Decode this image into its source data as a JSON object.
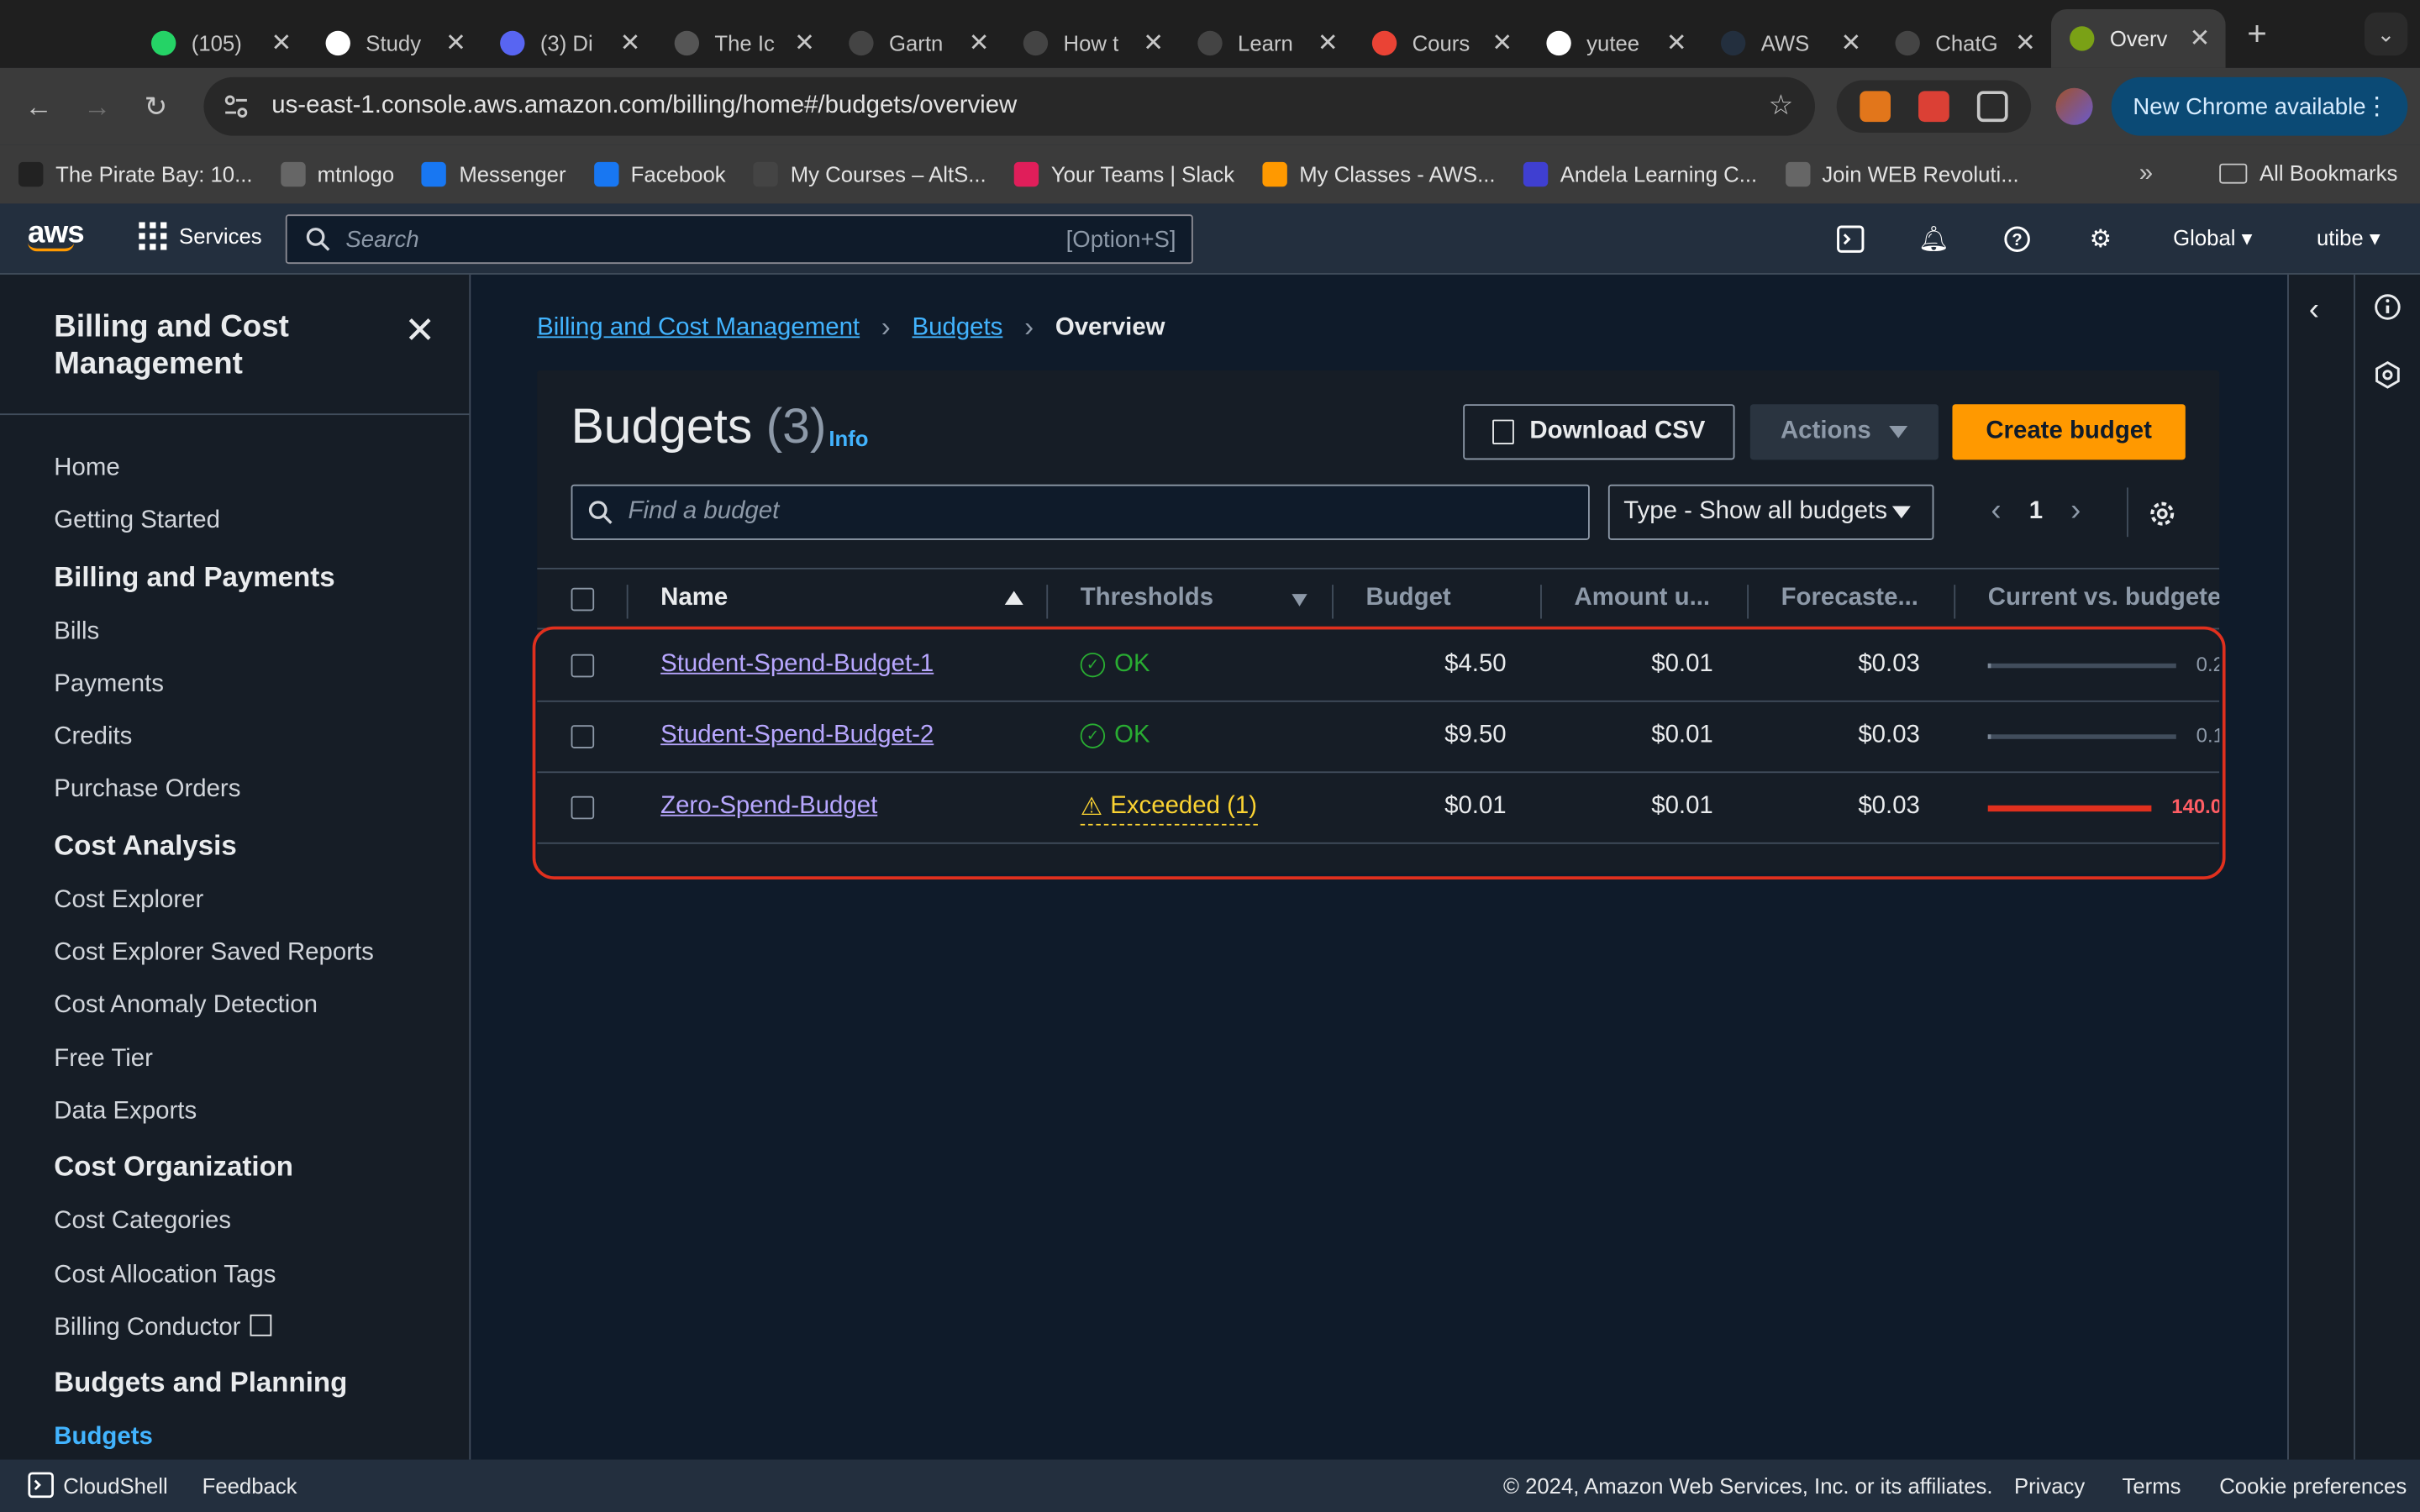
{
  "browser": {
    "tabs": [
      {
        "title": "(105)",
        "color": "#25d366",
        "icon": "whatsapp-icon"
      },
      {
        "title": "Study",
        "color": "#ffffff",
        "icon": "notion-icon"
      },
      {
        "title": "(3) Di",
        "color": "#5865f2",
        "icon": "discord-icon"
      },
      {
        "title": "The Ic",
        "color": "#555555",
        "icon": "gear-site-icon"
      },
      {
        "title": "Gartn",
        "color": "#444444",
        "icon": "g-icon"
      },
      {
        "title": "How t",
        "color": "#444444",
        "icon": "link-icon"
      },
      {
        "title": "Learn",
        "color": "#444444",
        "icon": "learn-icon"
      },
      {
        "title": "Cours",
        "color": "#ea4335",
        "icon": "courses-icon"
      },
      {
        "title": "yutee",
        "color": "#ffffff",
        "icon": "github-icon"
      },
      {
        "title": "AWS",
        "color": "#232f3e",
        "icon": "aws-icon"
      },
      {
        "title": "ChatG",
        "color": "#444444",
        "icon": "openai-icon"
      },
      {
        "title": "Overv",
        "color": "#7aa116",
        "icon": "billing-icon"
      }
    ],
    "url_host": "us-east-1.console.aws.amazon.com",
    "url_path": "/billing/home#/budgets/overview",
    "new_chrome": "New Chrome available",
    "bookmarks": [
      {
        "label": "The Pirate Bay: 10...",
        "color": "#222222",
        "icon": "pirate-icon"
      },
      {
        "label": "mtnlogo",
        "color": "#666666",
        "icon": "globe-icon"
      },
      {
        "label": "Messenger",
        "color": "#1877f2",
        "icon": "facebook-icon"
      },
      {
        "label": "Facebook",
        "color": "#1877f2",
        "icon": "facebook-icon"
      },
      {
        "label": "My Courses – AltS...",
        "color": "#444444",
        "icon": "altschool-icon"
      },
      {
        "label": "Your Teams | Slack",
        "color": "#e01e5a",
        "icon": "slack-icon"
      },
      {
        "label": "My Classes - AWS...",
        "color": "#ff9900",
        "icon": "aws-box-icon"
      },
      {
        "label": "Andela Learning C...",
        "color": "#3f3fd1",
        "icon": "andela-icon"
      },
      {
        "label": "Join WEB Revoluti...",
        "color": "#666666",
        "icon": "globe-icon"
      }
    ],
    "all_bookmarks": "All Bookmarks"
  },
  "aws_nav": {
    "logo": "aws",
    "services": "Services",
    "search_placeholder": "Search",
    "search_hint": "[Option+S]",
    "region": "Global",
    "user": "utibe"
  },
  "sidebar": {
    "title": "Billing and Cost Management",
    "items": [
      {
        "label": "Home",
        "type": "item"
      },
      {
        "label": "Getting Started",
        "type": "item"
      },
      {
        "label": "Billing and Payments",
        "type": "head"
      },
      {
        "label": "Bills",
        "type": "item"
      },
      {
        "label": "Payments",
        "type": "item"
      },
      {
        "label": "Credits",
        "type": "item"
      },
      {
        "label": "Purchase Orders",
        "type": "item"
      },
      {
        "label": "Cost Analysis",
        "type": "head"
      },
      {
        "label": "Cost Explorer",
        "type": "item"
      },
      {
        "label": "Cost Explorer Saved Reports",
        "type": "item"
      },
      {
        "label": "Cost Anomaly Detection",
        "type": "item"
      },
      {
        "label": "Free Tier",
        "type": "item"
      },
      {
        "label": "Data Exports",
        "type": "item"
      },
      {
        "label": "Cost Organization",
        "type": "head"
      },
      {
        "label": "Cost Categories",
        "type": "item"
      },
      {
        "label": "Cost Allocation Tags",
        "type": "item"
      },
      {
        "label": "Billing Conductor",
        "type": "item"
      },
      {
        "label": "Budgets and Planning",
        "type": "head"
      },
      {
        "label": "Budgets",
        "type": "active"
      }
    ]
  },
  "breadcrumb": {
    "items": [
      "Billing and Cost Management",
      "Budgets"
    ],
    "current": "Overview"
  },
  "budgets": {
    "title": "Budgets",
    "count": "(3)",
    "info": "Info",
    "download_csv": "Download CSV",
    "actions": "Actions",
    "create": "Create budget",
    "find_placeholder": "Find a budget",
    "type_filter": "Type - Show all budgets",
    "page": "1",
    "columns": [
      "Name",
      "Thresholds",
      "Budget",
      "Amount u...",
      "Forecaste...",
      "Current vs. budgeted"
    ],
    "rows": [
      {
        "name": "Student-Spend-Budget-1",
        "threshold": "OK",
        "status": "ok",
        "budget": "$4.50",
        "amount": "$0.01",
        "forecast": "$0.03",
        "progress": 0.0022,
        "pct": "0.2"
      },
      {
        "name": "Student-Spend-Budget-2",
        "threshold": "OK",
        "status": "ok",
        "budget": "$9.50",
        "amount": "$0.01",
        "forecast": "$0.03",
        "progress": 0.0011,
        "pct": "0.1"
      },
      {
        "name": "Zero-Spend-Budget",
        "threshold": "Exceeded (1)",
        "status": "exceeded",
        "budget": "$0.01",
        "amount": "$0.01",
        "forecast": "$0.03",
        "progress": 1.0,
        "pct": "140.0"
      }
    ]
  },
  "footer": {
    "cloudshell": "CloudShell",
    "feedback": "Feedback",
    "copyright": "© 2024, Amazon Web Services, Inc. or its affiliates.",
    "privacy": "Privacy",
    "terms": "Terms",
    "cookies": "Cookie preferences"
  }
}
